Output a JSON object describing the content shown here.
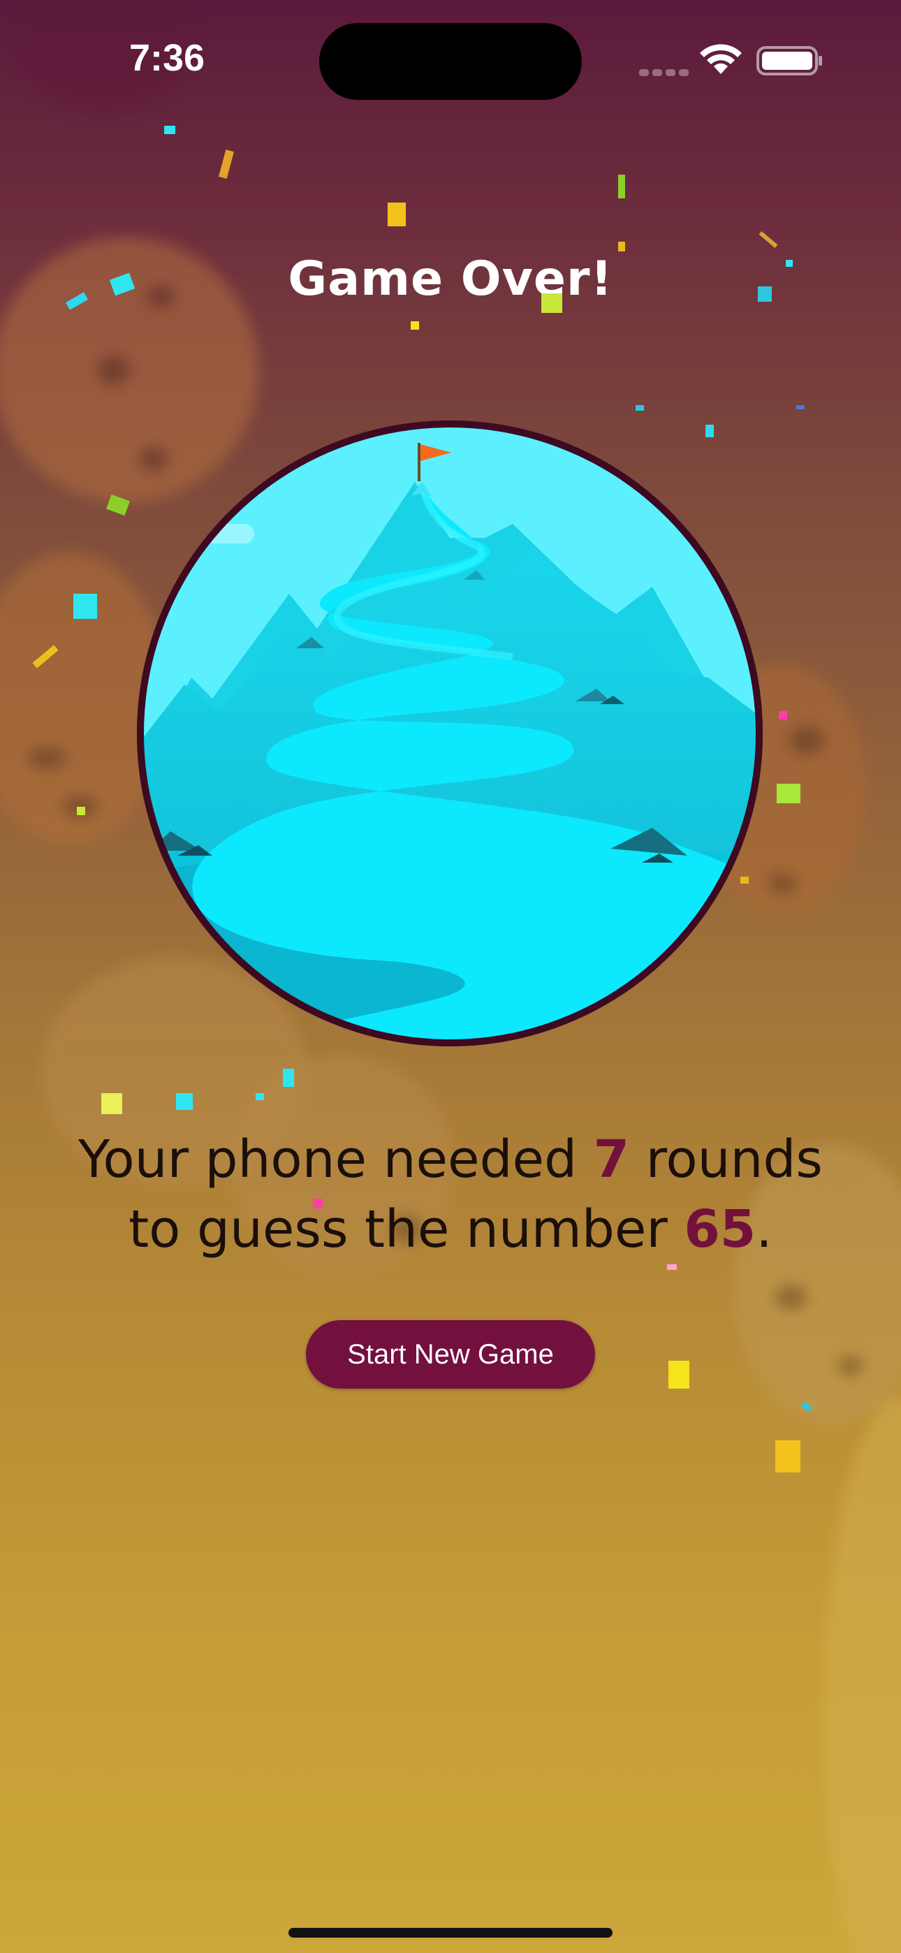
{
  "status_bar": {
    "time": "7:36"
  },
  "screen": {
    "title": "Game Over!",
    "illustration_icon": "mountain-summit-flag-illustration",
    "message": {
      "part1": "Your phone needed ",
      "rounds": "7",
      "part2": " rounds",
      "part3": "to guess the number ",
      "number": "65",
      "part4": "."
    },
    "button_label": "Start New Game"
  },
  "colors": {
    "accent": "#74103e",
    "highlight_text": "#73113c",
    "title_text": "#ffffff"
  },
  "icons": {
    "wifi": "wifi-icon",
    "battery": "battery-icon",
    "signal": "cellular-signal-icon"
  }
}
